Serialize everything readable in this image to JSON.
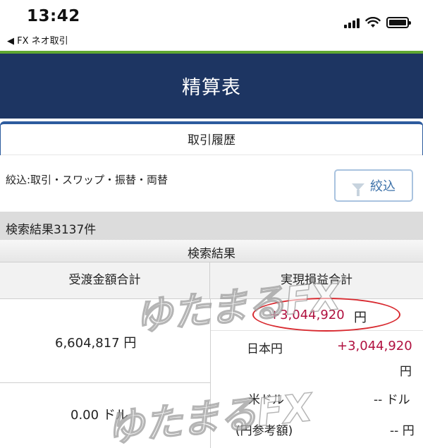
{
  "status_bar": {
    "time": "13:42",
    "back_app": "◀ FX ネオ取引"
  },
  "header": {
    "title": "精算表"
  },
  "tab": {
    "label": "取引履歴"
  },
  "filter": {
    "text": "絞込:取引・スワップ・振替・両替",
    "button_label": "絞込"
  },
  "results": {
    "count_text": "検索結果3137件",
    "section_label": "検索結果"
  },
  "table": {
    "left_header": "受渡金額合計",
    "right_header": "実現損益合計",
    "transfer_total": "6,604,817",
    "transfer_total_unit": "円",
    "transfer_usd": "0.00",
    "transfer_usd_unit": "ドル",
    "pl_total": "+3,044,920",
    "pl_total_unit": "円",
    "rows": [
      {
        "label": "日本円",
        "value": "+3,044,920",
        "unit": "円"
      },
      {
        "label": "米ドル",
        "sub_label": "(円参考額)",
        "value": "--",
        "unit": "ドル",
        "ref_value": "--",
        "ref_unit": "円"
      }
    ]
  },
  "watermark": {
    "text": "ゆたまるFX"
  },
  "colors": {
    "header_bg": "#1d3562",
    "accent_green": "#5fa831",
    "positive_red": "#b0103f",
    "highlight_circle": "#d8292f"
  }
}
